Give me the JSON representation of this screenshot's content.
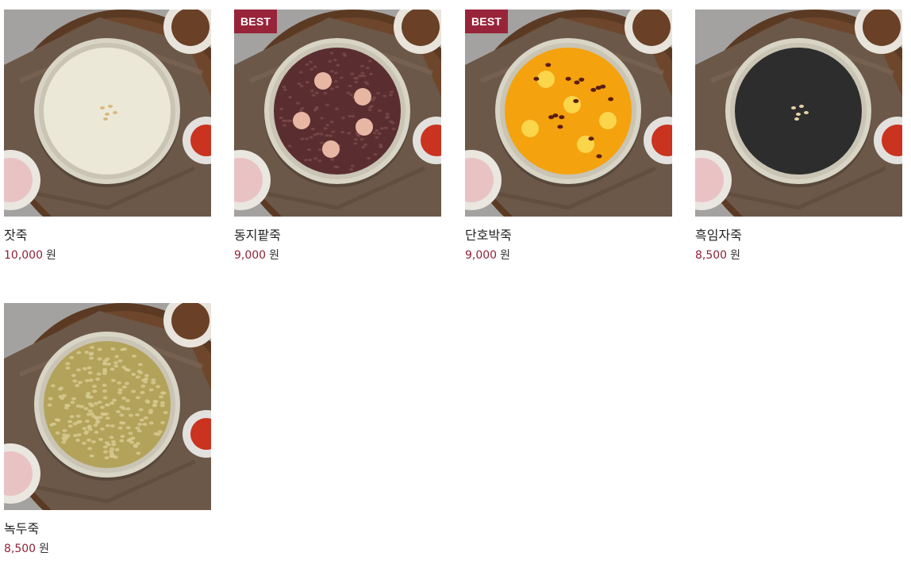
{
  "products": [
    {
      "name": "잣죽",
      "price": "10,000",
      "currency": "원",
      "badge": null,
      "image": {
        "porridge_color": "#ece8d8",
        "garnish": "pine-nuts",
        "garnish_color": "#d9b97a"
      }
    },
    {
      "name": "동지팥죽",
      "price": "9,000",
      "currency": "원",
      "badge": "BEST",
      "image": {
        "porridge_color": "#5a2e30",
        "garnish": "rice-balls",
        "garnish_color": "#e8b7a4"
      }
    },
    {
      "name": "단호박죽",
      "price": "9,000",
      "currency": "원",
      "badge": "BEST",
      "image": {
        "porridge_color": "#f4a20e",
        "garnish": "balls-and-beans",
        "garnish_color": "#fbd54a"
      }
    },
    {
      "name": "흑임자죽",
      "price": "8,500",
      "currency": "원",
      "badge": null,
      "image": {
        "porridge_color": "#2d2d2d",
        "garnish": "pine-nuts",
        "garnish_color": "#e6d3a8"
      }
    },
    {
      "name": "녹두죽",
      "price": "8,500",
      "currency": "원",
      "badge": null,
      "image": {
        "porridge_color": "#b3a25a",
        "garnish": "mung-grains",
        "garnish_color": "#d6c98f"
      }
    }
  ],
  "colors": {
    "price": "#8f2236",
    "badge": "#98243a",
    "name": "#222222"
  }
}
